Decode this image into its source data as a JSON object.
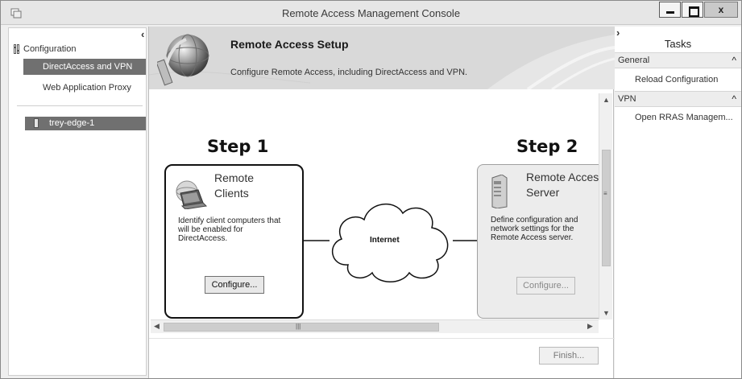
{
  "window": {
    "title": "Remote Access Management Console",
    "close_label": "x"
  },
  "nav": {
    "root_label": "Configuration",
    "items": [
      {
        "label": "DirectAccess and VPN",
        "selected": true
      },
      {
        "label": "Web Application Proxy",
        "selected": false
      }
    ],
    "server_label": "trey-edge-1"
  },
  "banner": {
    "title": "Remote Access Setup",
    "subtitle": "Configure Remote Access, including DirectAccess and VPN."
  },
  "steps": {
    "step1": {
      "title": "Step 1",
      "card_title_line1": "Remote",
      "card_title_line2": "Clients",
      "description": "Identify client computers that will be enabled for DirectAccess.",
      "button": "Configure..."
    },
    "step2": {
      "title": "Step 2",
      "card_title_line1": "Remote Access",
      "card_title_line2": "Server",
      "description": "Define configuration and network settings for the Remote Access server.",
      "button": "Configure..."
    },
    "cloud_label": "Internet"
  },
  "footer": {
    "finish_label": "Finish..."
  },
  "tasks": {
    "header": "Tasks",
    "sections": [
      {
        "label": "General",
        "items": [
          "Reload Configuration"
        ]
      },
      {
        "label": "VPN",
        "items": [
          "Open RRAS Managem..."
        ]
      }
    ]
  }
}
